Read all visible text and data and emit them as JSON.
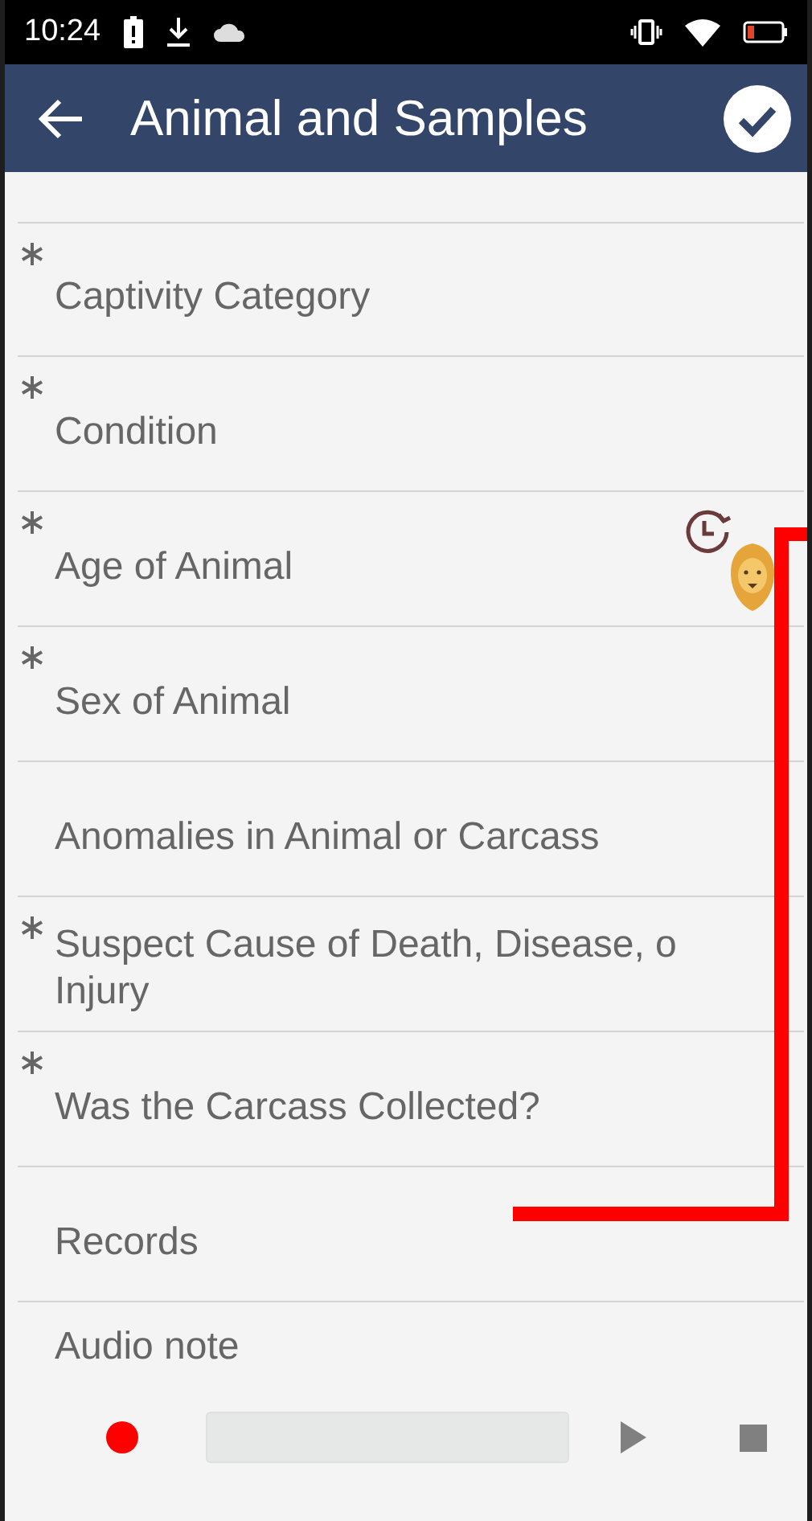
{
  "status_bar": {
    "time": "10:24"
  },
  "app_bar": {
    "title": "Animal and Samples"
  },
  "fields": [
    {
      "lines": [
        "Captivity Category"
      ],
      "required": true
    },
    {
      "lines": [
        "Condition"
      ],
      "required": true
    },
    {
      "lines": [
        "Age of Animal"
      ],
      "required": true,
      "has_history": true,
      "has_animal_badge": true
    },
    {
      "lines": [
        "Sex of Animal"
      ],
      "required": true
    },
    {
      "lines": [
        "Anomalies in Animal or Carcass"
      ],
      "required": false
    },
    {
      "lines": [
        "Suspect Cause of Death, Disease, o",
        "Injury"
      ],
      "required": true
    },
    {
      "lines": [
        "Was the Carcass Collected?"
      ],
      "required": true
    },
    {
      "lines": [
        "Records"
      ],
      "required": false
    }
  ],
  "audio_note": {
    "label": "Audio note"
  }
}
